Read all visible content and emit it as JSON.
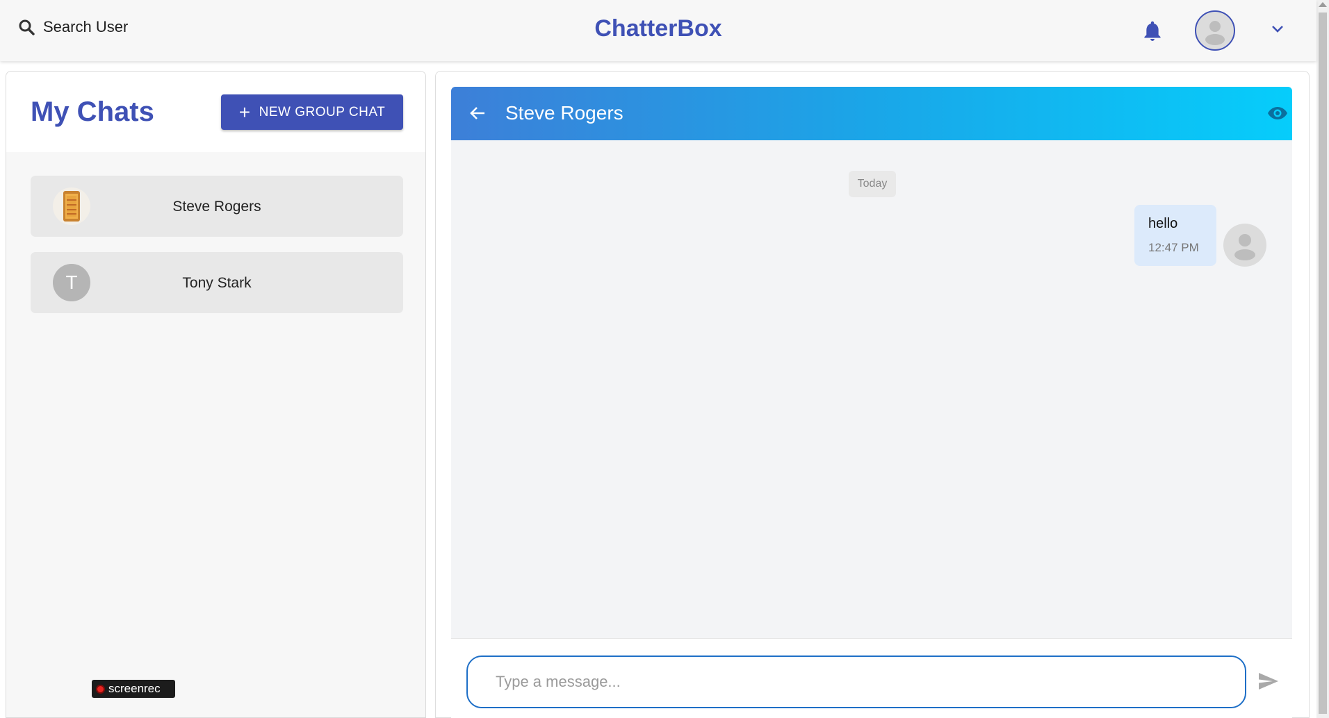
{
  "header": {
    "search_label": "Search User",
    "brand": "ChatterBox",
    "icons": [
      "search-icon",
      "bell-icon",
      "user-avatar-icon",
      "chevron-down-icon"
    ],
    "brand_color": "#3f51b5"
  },
  "sidebar": {
    "title": "My Chats",
    "new_group_label": "NEW GROUP CHAT",
    "chats": [
      {
        "name": "Steve Rogers",
        "avatar": "photo"
      },
      {
        "name": "Tony Stark",
        "avatar_letter": "T"
      }
    ],
    "watermark": "screenrec"
  },
  "chat": {
    "title": "Steve Rogers",
    "icons": [
      "back-arrow-icon",
      "eye-icon",
      "send-icon"
    ],
    "date_divider": "Today",
    "messages": [
      {
        "text": "hello",
        "time": "12:47 PM",
        "sender": "self"
      }
    ],
    "input_placeholder": "Type a message...",
    "input_value": "",
    "header_gradient": [
      "#3d7fd8",
      "#06cdfb"
    ],
    "input_border_color": "#1e6fc7"
  }
}
